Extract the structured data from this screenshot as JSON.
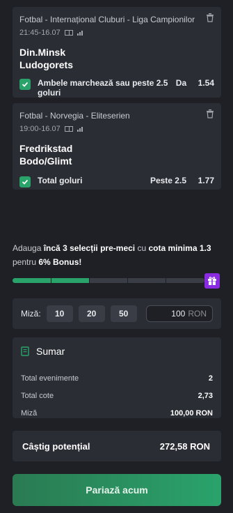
{
  "colors": {
    "accent_green": "#2aa36b",
    "gift_purple": "#8a2be2",
    "card_bg": "#2a2d34",
    "page_bg": "#1e2026"
  },
  "bets": [
    {
      "league": "Fotbal - Internațional Cluburi - Liga Campionilor",
      "datetime": "21:45-16.07",
      "home": "Din.Minsk",
      "away": "Ludogorets",
      "selection": "Ambele marchează sau peste 2.5 goluri",
      "pick": "Da",
      "odd": "1.54"
    },
    {
      "league": "Fotbal - Norvegia - Eliteserien",
      "datetime": "19:00-16.07",
      "home": "Fredrikstad",
      "away": "Bodo/Glimt",
      "selection": "Total goluri",
      "pick": "Peste 2.5",
      "odd": "1.77"
    }
  ],
  "bonus": {
    "p1": "Adauga",
    "b1": "încă 3 selecții pre-meci",
    "p2": "cu",
    "b2": "cota minima 1.3",
    "p3": "pentru",
    "b3": "6% Bonus!",
    "progress_fraction": 0.4
  },
  "stake": {
    "label": "Miză:",
    "chips": [
      "10",
      "20",
      "50"
    ],
    "value": "100",
    "currency": "RON"
  },
  "summary": {
    "title": "Sumar",
    "rows": [
      {
        "label": "Total evenimente",
        "value": "2"
      },
      {
        "label": "Total cote",
        "value": "2,73"
      },
      {
        "label": "Miză",
        "value": "100,00 RON"
      }
    ]
  },
  "win": {
    "label": "Câștig potențial",
    "value": "272,58 RON"
  },
  "cta": {
    "label": "Pariază acum"
  },
  "icons": [
    "trash-icon",
    "pitch-icon",
    "stats-icon",
    "check-icon",
    "gift-icon",
    "summary-book-icon"
  ]
}
